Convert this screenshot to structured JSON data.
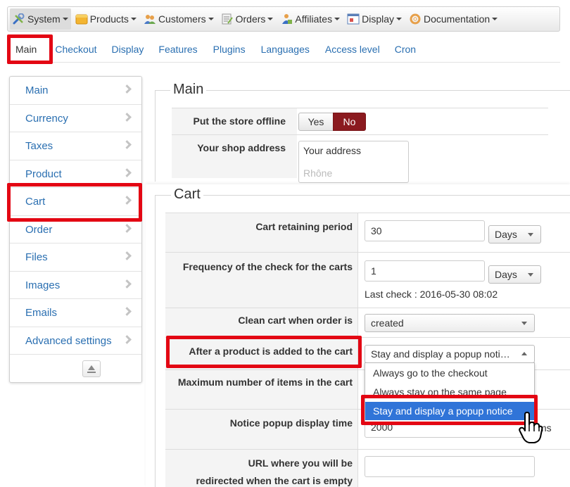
{
  "menubar": {
    "items": [
      {
        "label": "System",
        "icon": "wrench-icon",
        "active": true
      },
      {
        "label": "Products",
        "icon": "box-icon"
      },
      {
        "label": "Customers",
        "icon": "users-icon"
      },
      {
        "label": "Orders",
        "icon": "orders-icon"
      },
      {
        "label": "Affiliates",
        "icon": "affiliates-icon"
      },
      {
        "label": "Display",
        "icon": "display-icon"
      },
      {
        "label": "Documentation",
        "icon": "help-icon"
      }
    ]
  },
  "subnav": {
    "items": [
      "Main",
      "Checkout",
      "Display",
      "Features",
      "Plugins",
      "Languages",
      "Access level",
      "Cron"
    ],
    "selected": "Main"
  },
  "sidebar": {
    "items": [
      "Main",
      "Currency",
      "Taxes",
      "Product",
      "Cart",
      "Order",
      "Files",
      "Images",
      "Emails",
      "Advanced settings"
    ]
  },
  "main_section": {
    "legend": "Main",
    "offline_label": "Put the store offline",
    "yes_label": "Yes",
    "no_label": "No",
    "address_label": "Your shop address",
    "address_value": "Your address",
    "address_line2": "Rhône"
  },
  "cart_section": {
    "legend": "Cart",
    "retaining_label": "Cart retaining period",
    "retaining_value": "30",
    "retaining_unit": "Days",
    "frequency_label": "Frequency of the check for the carts",
    "frequency_value": "1",
    "frequency_unit": "Days",
    "last_check": "Last check : 2016-05-30 08:02",
    "clean_label": "Clean cart when order is",
    "clean_value": "created",
    "after_add_label": "After a product is added to the cart",
    "after_add_value": "Stay and display a popup noti…",
    "after_add_options": [
      "Always go to the checkout",
      "Always stay on the same page",
      "Stay and display a popup notice"
    ],
    "max_items_label": "Maximum number of items in the cart",
    "notice_time_label": "Notice popup display time",
    "notice_time_value": "2000",
    "notice_time_unit": "ms",
    "url_label_line1": "URL where you will be",
    "url_label_line2": "redirected when the cart is empty",
    "url_value": ""
  },
  "colors": {
    "highlight": "#e30613",
    "link": "#2a6fb1",
    "no_button": "#8b1a1f",
    "selected_option": "#3074d8"
  }
}
